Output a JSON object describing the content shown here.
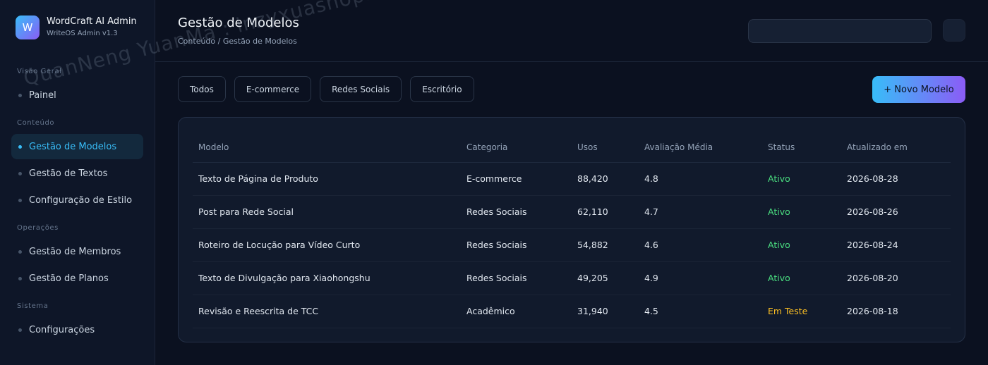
{
  "brand": {
    "logo_letter": "W",
    "title": "WordCraft AI Admin",
    "subtitle": "WriteOS Admin v1.3"
  },
  "sidebar": {
    "sections": [
      {
        "label": "Visão Geral",
        "items": [
          {
            "label": "Painel",
            "active": false
          }
        ]
      },
      {
        "label": "Conteúdo",
        "items": [
          {
            "label": "Gestão de Modelos",
            "active": true
          },
          {
            "label": "Gestão de Textos",
            "active": false
          },
          {
            "label": "Configuração de Estilo",
            "active": false
          }
        ]
      },
      {
        "label": "Operações",
        "items": [
          {
            "label": "Gestão de Membros",
            "active": false
          },
          {
            "label": "Gestão de Planos",
            "active": false
          }
        ]
      },
      {
        "label": "Sistema",
        "items": [
          {
            "label": "Configurações",
            "active": false
          }
        ]
      }
    ]
  },
  "header": {
    "title": "Gestão de Modelos",
    "breadcrumb": "Conteúdo / Gestão de Modelos",
    "search_placeholder": ""
  },
  "filters": [
    "Todos",
    "E-commerce",
    "Redes Sociais",
    "Escritório"
  ],
  "new_button_label": "+ Novo Modelo",
  "table": {
    "columns": [
      "Modelo",
      "Categoria",
      "Usos",
      "Avaliação Média",
      "Status",
      "Atualizado em"
    ],
    "rows": [
      [
        "Texto de Página de Produto",
        "E-commerce",
        "88,420",
        "4.8",
        "Ativo",
        "2026-08-28"
      ],
      [
        "Post para Rede Social",
        "Redes Sociais",
        "62,110",
        "4.7",
        "Ativo",
        "2026-08-26"
      ],
      [
        "Roteiro de Locução para Vídeo Curto",
        "Redes Sociais",
        "54,882",
        "4.6",
        "Ativo",
        "2026-08-24"
      ],
      [
        "Texto de Divulgação para Xiaohongshu",
        "Redes Sociais",
        "49,205",
        "4.9",
        "Ativo",
        "2026-08-20"
      ],
      [
        "Revisão e Reescrita de TCC",
        "Acadêmico",
        "31,940",
        "4.5",
        "Em Teste",
        "2026-08-18"
      ]
    ]
  },
  "colors": {
    "accent": "#38bdf8",
    "status_active": "#4ade80",
    "status_testing": "#fbbf24"
  },
  "watermark": "QuanNeng YuanMa : inzyxuashop.com"
}
